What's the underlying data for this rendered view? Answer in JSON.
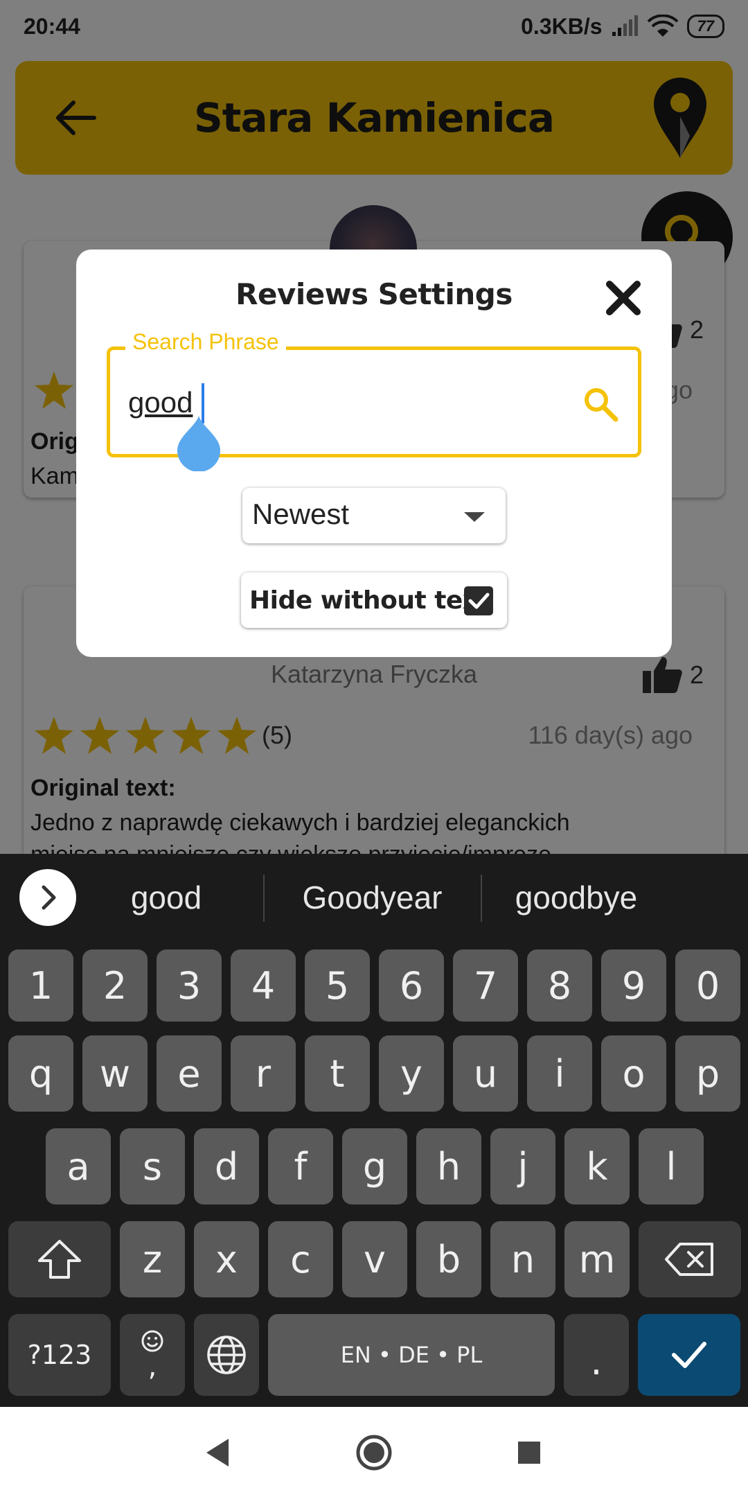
{
  "status_bar": {
    "time": "20:44",
    "net_speed": "0.3KB/s",
    "battery": "77"
  },
  "header": {
    "title": "Stara Kamienica"
  },
  "background_reviews": [
    {
      "likes": "2",
      "time_ago": "ago",
      "label_fragment": "Orig",
      "text_fragment": "Kam"
    },
    {
      "reviewer": "Katarzyna Fryczka",
      "likes": "2",
      "rating_text": "(5)",
      "rating": 5,
      "time_ago": "116 day(s) ago",
      "label": "Original text:",
      "text": "Jedno z naprawdę ciekawych i bardziej eleganckich",
      "text_line2": "miejsc na mniejsze czy większe przyjęcie/imprezę"
    }
  ],
  "dialog": {
    "title": "Reviews Settings",
    "search": {
      "label": "Search Phrase",
      "value": "good"
    },
    "sort": {
      "selected": "Newest"
    },
    "hide_without_text": {
      "label": "Hide without text",
      "checked": true
    }
  },
  "keyboard": {
    "suggestions": [
      "good",
      "Goodyear",
      "goodbye"
    ],
    "number_row": [
      "1",
      "2",
      "3",
      "4",
      "5",
      "6",
      "7",
      "8",
      "9",
      "0"
    ],
    "row1": [
      "q",
      "w",
      "e",
      "r",
      "t",
      "y",
      "u",
      "i",
      "o",
      "p"
    ],
    "row2": [
      "a",
      "s",
      "d",
      "f",
      "g",
      "h",
      "j",
      "k",
      "l"
    ],
    "row3": [
      "z",
      "x",
      "c",
      "v",
      "b",
      "n",
      "m"
    ],
    "symbols_key": "?123",
    "comma_key": ",",
    "space_label": "EN • DE • PL",
    "period_key": "."
  },
  "colors": {
    "accent": "#f5c20a",
    "enter_key": "#0b4a72",
    "keyboard_bg": "#1b1b1b"
  }
}
